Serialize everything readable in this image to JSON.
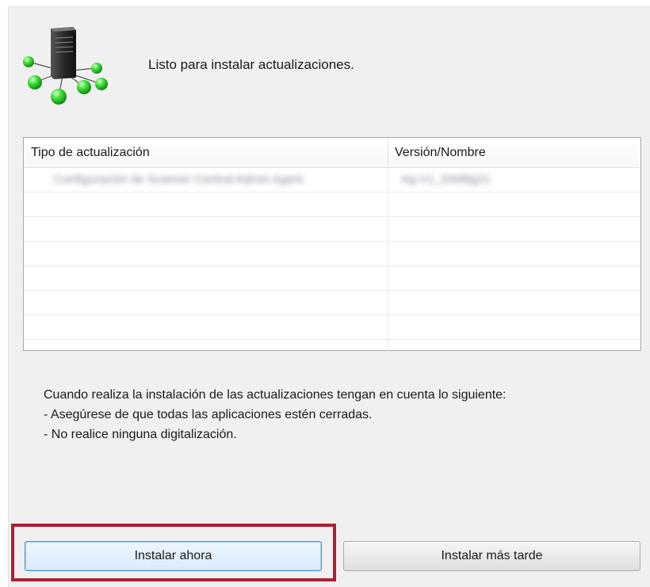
{
  "header": {
    "message": "Listo para instalar actualizaciones.",
    "icon": "server-network-icon"
  },
  "table": {
    "columns": [
      "Tipo de actualización",
      "Versión/Nombre"
    ],
    "rows": [
      [
        "Configuración de Scanner Central Admin Agent",
        "Ag-V1_SWBlg21"
      ]
    ]
  },
  "notes": {
    "line1": "Cuando realiza la instalación de las actualizaciones tengan en cuenta lo siguiente:",
    "line2": "- Asegúrese de que todas las aplicaciones estén cerradas.",
    "line3": "- No realice ninguna digitalización."
  },
  "buttons": {
    "install_now": "Instalar ahora",
    "install_later": "Instalar más tarde"
  },
  "colors": {
    "highlight_border": "#b01e34",
    "primary_button_border": "#4a90d9",
    "node_green": "#2fd12f"
  }
}
